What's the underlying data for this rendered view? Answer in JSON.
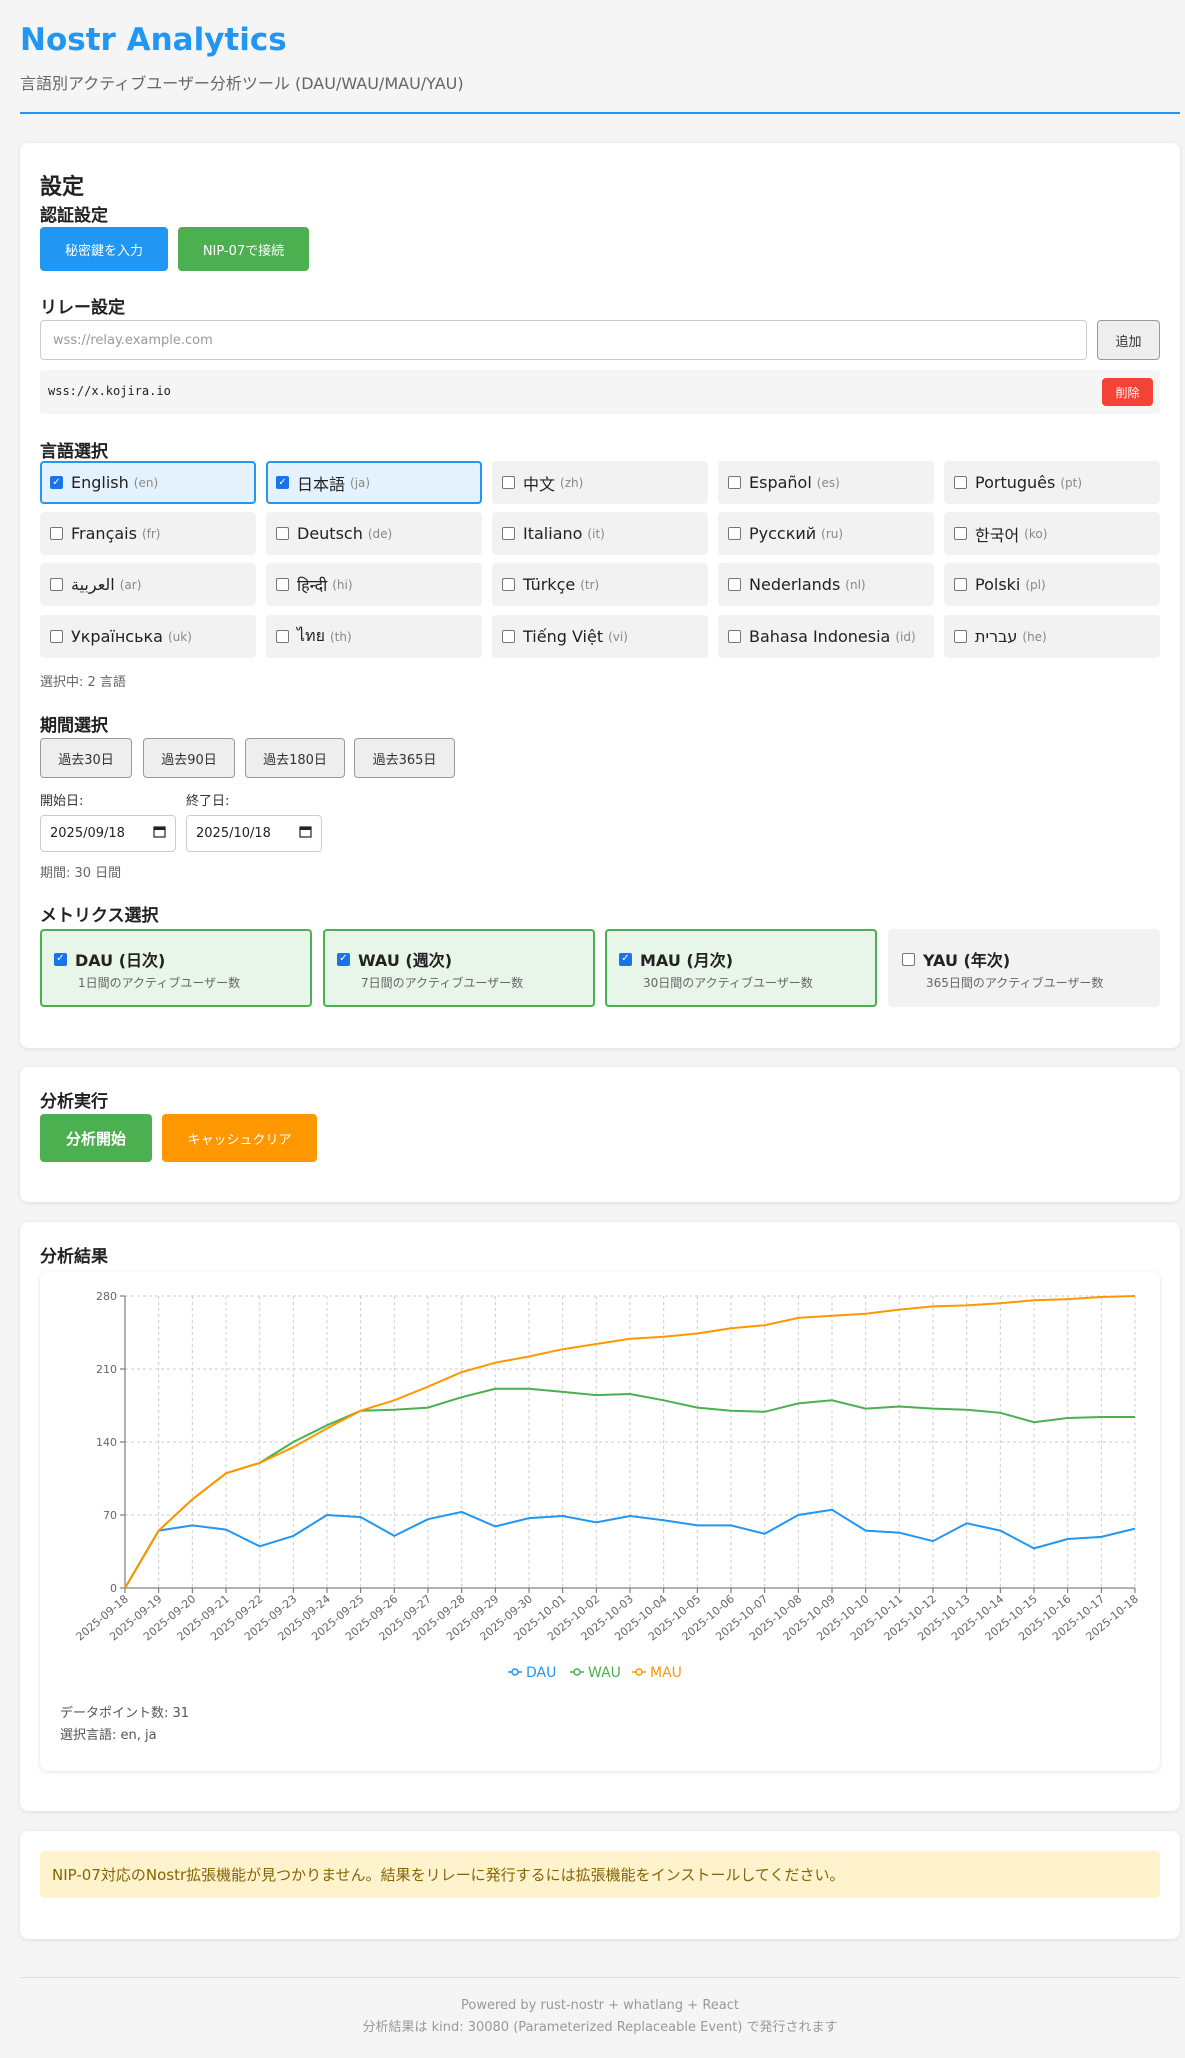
{
  "header": {
    "title": "Nostr Analytics",
    "subtitle": "言語別アクティブユーザー分析ツール (DAU/WAU/MAU/YAU)"
  },
  "settings": {
    "title": "設定",
    "auth": {
      "title": "認証設定",
      "secret_key_button": "秘密鍵を入力",
      "nip07_button": "NIP-07で接続"
    },
    "relay": {
      "title": "リレー設定",
      "input_placeholder": "wss://relay.example.com",
      "add_button": "追加",
      "relays": [
        {
          "url": "wss://x.kojira.io",
          "delete_label": "削除"
        }
      ]
    },
    "language": {
      "title": "言語選択",
      "items": [
        {
          "name": "English",
          "code": "(en)",
          "selected": true
        },
        {
          "name": "日本語",
          "code": "(ja)",
          "selected": true
        },
        {
          "name": "中文",
          "code": "(zh)",
          "selected": false
        },
        {
          "name": "Español",
          "code": "(es)",
          "selected": false
        },
        {
          "name": "Português",
          "code": "(pt)",
          "selected": false
        },
        {
          "name": "Français",
          "code": "(fr)",
          "selected": false
        },
        {
          "name": "Deutsch",
          "code": "(de)",
          "selected": false
        },
        {
          "name": "Italiano",
          "code": "(it)",
          "selected": false
        },
        {
          "name": "Русский",
          "code": "(ru)",
          "selected": false
        },
        {
          "name": "한국어",
          "code": "(ko)",
          "selected": false
        },
        {
          "name": "العربية",
          "code": "(ar)",
          "selected": false
        },
        {
          "name": "हिन्दी",
          "code": "(hi)",
          "selected": false
        },
        {
          "name": "Türkçe",
          "code": "(tr)",
          "selected": false
        },
        {
          "name": "Nederlands",
          "code": "(nl)",
          "selected": false
        },
        {
          "name": "Polski",
          "code": "(pl)",
          "selected": false
        },
        {
          "name": "Українська",
          "code": "(uk)",
          "selected": false
        },
        {
          "name": "ไทย",
          "code": "(th)",
          "selected": false
        },
        {
          "name": "Tiếng Việt",
          "code": "(vi)",
          "selected": false
        },
        {
          "name": "Bahasa Indonesia",
          "code": "(id)",
          "selected": false
        },
        {
          "name": "עברית",
          "code": "(he)",
          "selected": false
        }
      ],
      "selected_count_text": "選択中: 2 言語"
    },
    "period": {
      "title": "期間選択",
      "presets": [
        "過去30日",
        "過去90日",
        "過去180日",
        "過去365日"
      ],
      "start_label": "開始日:",
      "start_value": "2025/09/18",
      "end_label": "終了日:",
      "end_value": "2025/10/18",
      "duration_text": "期間: 30 日間"
    },
    "metrics": {
      "title": "メトリクス選択",
      "items": [
        {
          "title": "DAU (日次)",
          "desc": "1日間のアクティブユーザー数",
          "selected": true
        },
        {
          "title": "WAU (週次)",
          "desc": "7日間のアクティブユーザー数",
          "selected": true
        },
        {
          "title": "MAU (月次)",
          "desc": "30日間のアクティブユーザー数",
          "selected": true
        },
        {
          "title": "YAU (年次)",
          "desc": "365日間のアクティブユーザー数",
          "selected": false
        }
      ]
    }
  },
  "run": {
    "title": "分析実行",
    "start_button": "分析開始",
    "clear_cache_button": "キャッシュクリア"
  },
  "results": {
    "title": "分析結果",
    "data_points_text": "データポイント数: 31",
    "selected_langs_text": "選択言語: en, ja"
  },
  "chart_data": {
    "type": "line",
    "x": [
      "2025-09-18",
      "2025-09-19",
      "2025-09-20",
      "2025-09-21",
      "2025-09-22",
      "2025-09-23",
      "2025-09-24",
      "2025-09-25",
      "2025-09-26",
      "2025-09-27",
      "2025-09-28",
      "2025-09-29",
      "2025-09-30",
      "2025-10-01",
      "2025-10-02",
      "2025-10-03",
      "2025-10-04",
      "2025-10-05",
      "2025-10-06",
      "2025-10-07",
      "2025-10-08",
      "2025-10-09",
      "2025-10-10",
      "2025-10-11",
      "2025-10-12",
      "2025-10-13",
      "2025-10-14",
      "2025-10-15",
      "2025-10-16",
      "2025-10-17",
      "2025-10-18"
    ],
    "yticks": [
      0,
      70,
      140,
      210,
      280
    ],
    "ylim": [
      0,
      280
    ],
    "grid": true,
    "legend_position": "bottom",
    "series": [
      {
        "name": "DAU",
        "color": "#2196f3",
        "values": [
          0,
          55,
          60,
          56,
          40,
          50,
          70,
          68,
          50,
          66,
          73,
          59,
          67,
          69,
          63,
          69,
          65,
          60,
          60,
          52,
          70,
          75,
          55,
          53,
          45,
          62,
          55,
          38,
          47,
          49,
          57
        ]
      },
      {
        "name": "WAU",
        "color": "#4caf50",
        "values": [
          0,
          55,
          85,
          110,
          120,
          140,
          156,
          170,
          171,
          173,
          183,
          191,
          191,
          188,
          185,
          186,
          180,
          173,
          170,
          169,
          177,
          180,
          172,
          174,
          172,
          171,
          168,
          159,
          163,
          164,
          164
        ]
      },
      {
        "name": "MAU",
        "color": "#ff9800",
        "values": [
          0,
          55,
          85,
          110,
          120,
          135,
          153,
          170,
          180,
          193,
          207,
          216,
          222,
          229,
          234,
          239,
          241,
          244,
          249,
          252,
          259,
          261,
          263,
          267,
          270,
          271,
          273,
          276,
          277,
          279,
          280
        ]
      }
    ]
  },
  "notice": {
    "text": "NIP-07対応のNostr拡張機能が見つかりません。結果をリレーに発行するには拡張機能をインストールしてください。"
  },
  "footer": {
    "line1": "Powered by rust-nostr + whatlang + React",
    "line2": "分析結果は kind: 30080 (Parameterized Replaceable Event) で発行されます"
  }
}
